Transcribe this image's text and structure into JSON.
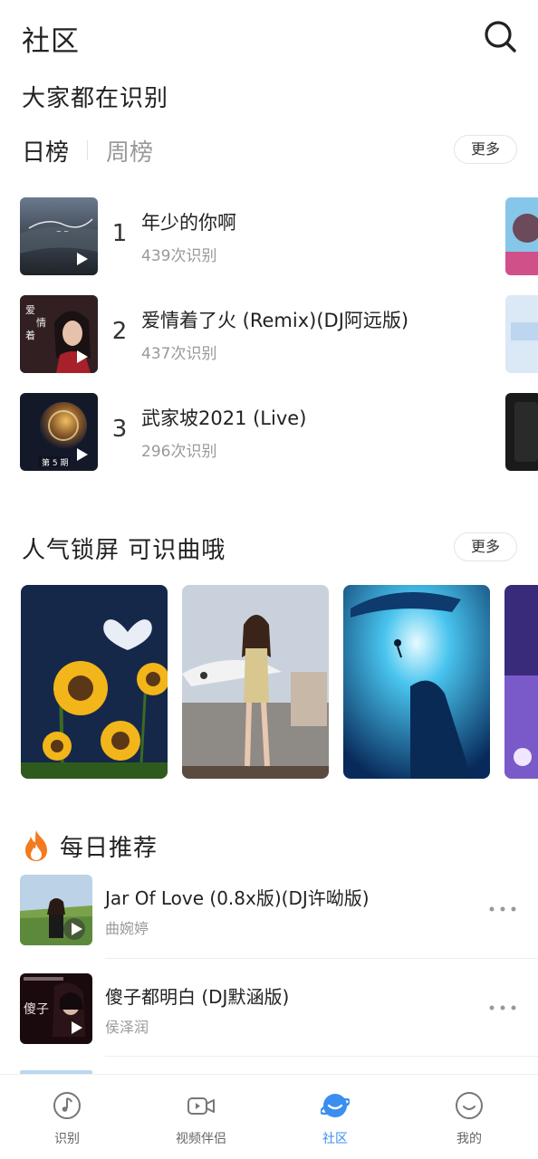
{
  "header": {
    "title": "社区",
    "search_icon": "search-icon"
  },
  "trending": {
    "title": "大家都在识别",
    "tabs": [
      {
        "label": "日榜",
        "active": true
      },
      {
        "label": "周榜",
        "active": false
      }
    ],
    "more_label": "更多",
    "items": [
      {
        "rank": "1",
        "title": "年少的你啊",
        "count": "439次识别"
      },
      {
        "rank": "2",
        "title": "爱情着了火 (Remix)(DJ阿远版)",
        "count": "437次识别"
      },
      {
        "rank": "3",
        "title": "武家坡2021 (Live)",
        "count": "296次识别"
      }
    ]
  },
  "wallpapers": {
    "title": "人气锁屏 可识曲哦",
    "more_label": "更多"
  },
  "daily": {
    "title": "每日推荐",
    "icon": "fire-icon",
    "songs": [
      {
        "title": "Jar Of Love (0.8x版)(DJ许呦版)",
        "artist": "曲婉婷"
      },
      {
        "title": "傻子都明白 (DJ默涵版)",
        "artist": "侯泽润"
      }
    ]
  },
  "tabbar": {
    "active_color": "#3a8ef0",
    "items": [
      {
        "label": "识别",
        "icon": "music-note-icon",
        "active": false
      },
      {
        "label": "视频伴侣",
        "icon": "video-camera-icon",
        "active": false
      },
      {
        "label": "社区",
        "icon": "planet-icon",
        "active": true
      },
      {
        "label": "我的",
        "icon": "smiley-face-icon",
        "active": false
      }
    ]
  }
}
